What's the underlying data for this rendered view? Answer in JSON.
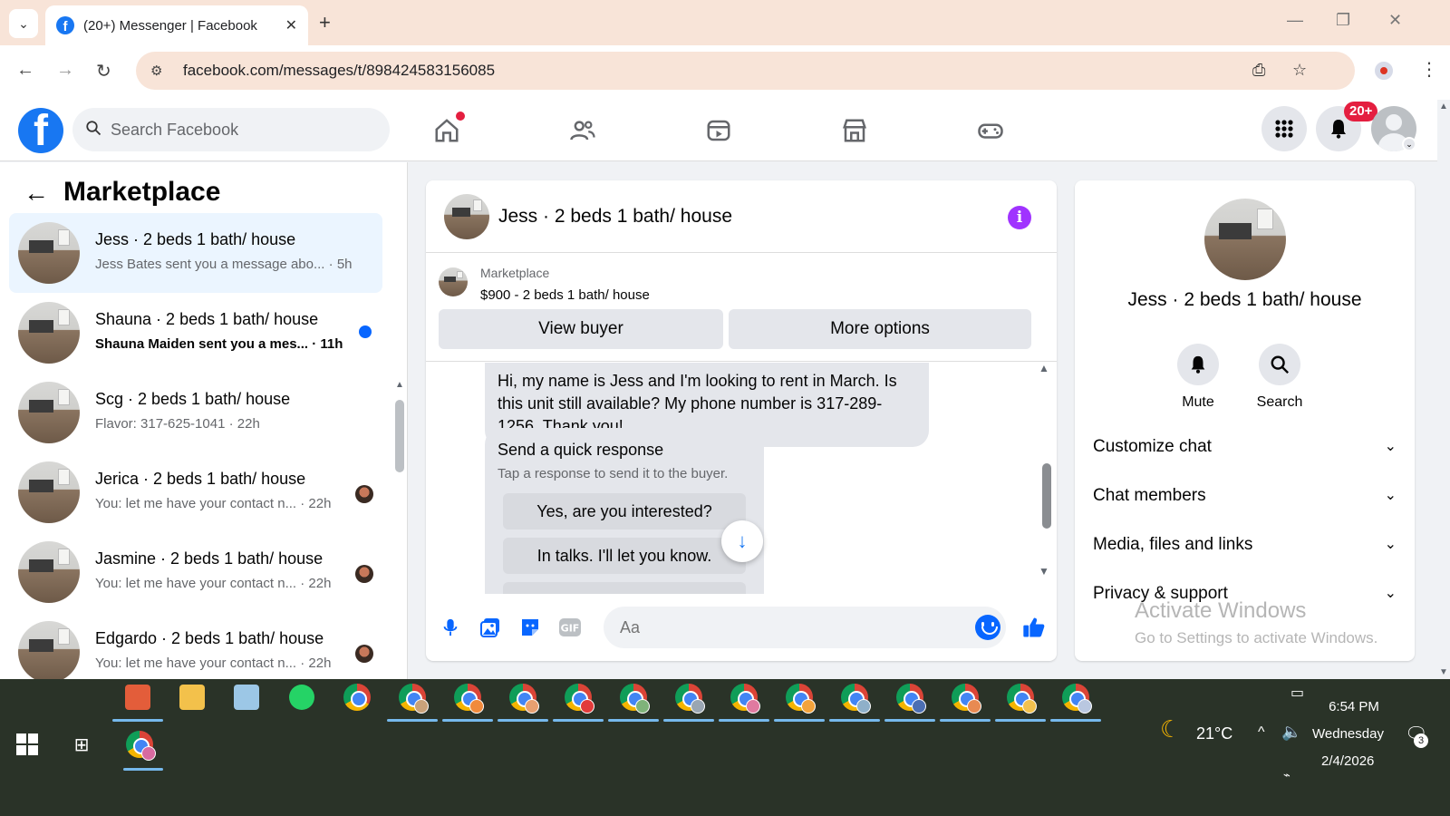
{
  "browser": {
    "tab_title": "(20+) Messenger | Facebook",
    "url": "facebook.com/messages/t/898424583156085"
  },
  "fb_header": {
    "search_placeholder": "Search Facebook",
    "notification_badge": "20+"
  },
  "sidebar": {
    "title": "Marketplace",
    "conversations": [
      {
        "name": "Jess · 2 beds 1 bath/ house",
        "preview": "Jess Bates sent you a message abo...",
        "time": " · 5h",
        "unread": false,
        "active": true
      },
      {
        "name": "Shauna · 2 beds 1 bath/ house",
        "preview": "Shauna Maiden sent you a mes...",
        "time": " · 11h",
        "unread": true,
        "active": false
      },
      {
        "name": "Scg · 2 beds 1 bath/ house",
        "preview": "Flavor: 317-625-1041",
        "time": " · 22h",
        "unread": false,
        "active": false
      },
      {
        "name": "Jerica · 2 beds 1 bath/ house",
        "preview": "You: let me have your contact n...",
        "time": " · 22h",
        "unread": false,
        "active": false
      },
      {
        "name": "Jasmine · 2 beds 1 bath/ house",
        "preview": "You: let me have your contact n...",
        "time": " · 22h",
        "unread": false,
        "active": false
      },
      {
        "name": "Edgardo · 2 beds 1 bath/ house",
        "preview": "You: let me have your contact n...",
        "time": " · 22h",
        "unread": false,
        "active": false
      }
    ]
  },
  "chat": {
    "title": "Jess · 2 beds 1 bath/ house",
    "marketplace_label": "Marketplace",
    "listing": "$900 - 2 beds 1 bath/ house",
    "view_buyer": "View buyer",
    "more_options": "More options",
    "message_text": "Hi, my name is Jess and I'm looking to rent in March. Is this unit still available? My phone number is 317-289-1256. Thank you!",
    "quick_response_title": "Send a quick response",
    "quick_response_sub": "Tap a response to send it to the buyer.",
    "quick_responses": [
      "Yes, are you interested?",
      "In talks. I'll let you know."
    ],
    "composer_placeholder": "Aa"
  },
  "info_panel": {
    "name": "Jess · 2 beds 1 bath/ house",
    "mute": "Mute",
    "search": "Search",
    "sections": [
      "Customize chat",
      "Chat members",
      "Media, files and links",
      "Privacy & support"
    ]
  },
  "watermark": {
    "line1": "Activate Windows",
    "line2": "Go to Settings to activate Windows."
  },
  "taskbar": {
    "weather": "21°C",
    "time": "6:54 PM",
    "day": "Wednesday",
    "date": "2/4/2026",
    "notification_count": "3"
  },
  "colors": {
    "fb_blue": "#1877f2",
    "messenger_blue": "#0866ff",
    "tab_strip": "#f8e4d8",
    "info_purple": "#a033ff",
    "badge_red": "#e41e3f"
  }
}
